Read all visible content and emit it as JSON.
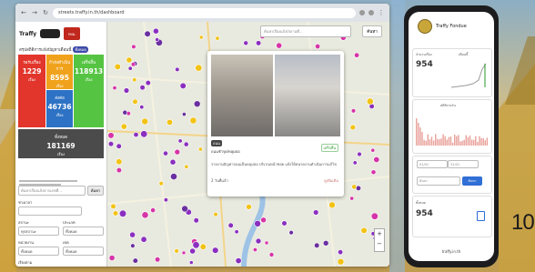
{
  "browser": {
    "address": "streets.traffy.in.th/dashboard"
  },
  "dashboard": {
    "brand": "Traffy",
    "badge_label": "กทม.",
    "stats_title": "สรุปสถิติการแจ้งปัญหาเดือนนี้",
    "stats_chip": "ทั้งหมด",
    "tiles": [
      {
        "label": "รอรับเรื่อง",
        "value": "1229",
        "unit": "เรื่อง",
        "color": "#e2352b"
      },
      {
        "label": "กำลังดำเนินการ",
        "value": "8595",
        "unit": "เรื่อง",
        "color": "#f0a21c"
      },
      {
        "label": "ส่งต่อ",
        "value": "46736",
        "unit": "เรื่อง",
        "color": "#2d72c4"
      },
      {
        "label": "เสร็จสิ้น",
        "value": "118913",
        "unit": "เรื่อง",
        "color": "#55c442"
      },
      {
        "label": "ทั้งหมด",
        "value": "181169",
        "unit": "เรื่อง",
        "color": "#4b4b4b"
      }
    ],
    "filters": {
      "search_placeholder": "ค้นหาเรื่องแจ้งจากเลขที่...",
      "search_button": "ค้นหา",
      "period_label": "ช่วงเวลา",
      "status_label": "สถานะ",
      "status_value": "ทุกสถานะ",
      "type_label": "ประเภท",
      "type_value": "ทั้งหมด",
      "agency_label": "หน่วยงาน",
      "agency_value": "ทั้งหมด",
      "area_label": "เขต",
      "area_value": "ทั้งหมด",
      "sort_label": "เรียงตาม"
    }
  },
  "map": {
    "search_placeholder": "ค้นหาเรื่องแจ้ง/สถานที่...",
    "search_button": "ค้นหา",
    "zoom_in": "+",
    "zoom_out": "−"
  },
  "popup": {
    "tag": "ถนน",
    "title": "ถนนชำรุด/หลุมบ่อ",
    "status": "เสร็จสิ้น",
    "description": "รายงานปัญหาถนนเป็นหลุมบ่อ บริเวณหน้าซอย แจ้งให้หน่วยงานดำเนินการแก้ไข",
    "footer": "2 วันที่แล้ว",
    "more": "ดูเพิ่มเติม"
  },
  "phone": {
    "header_title": "Traffy Fondue",
    "card1_label": "จำนวนเรื่อง",
    "card1_value": "954",
    "card1_tab": "เดือนนี้",
    "chart_title": "สถิติรายวัน",
    "date_from": "01/01",
    "date_to": "31/01",
    "search_placeholder": "ค้นหา",
    "search_button": "ค้นหา",
    "card2_label": "ทั้งหมด",
    "card2_value": "954",
    "url": "traffy.in.th"
  },
  "backdrop": {
    "slide_number": "10"
  },
  "colors": {
    "red": "#e2352b",
    "orange": "#f0a21c",
    "blue": "#2d72c4",
    "green": "#55c442",
    "dark": "#4b4b4b",
    "pin_purple": "#8a2fbf",
    "pin_magenta": "#d633a8",
    "pin_yellow": "#f2c316"
  }
}
